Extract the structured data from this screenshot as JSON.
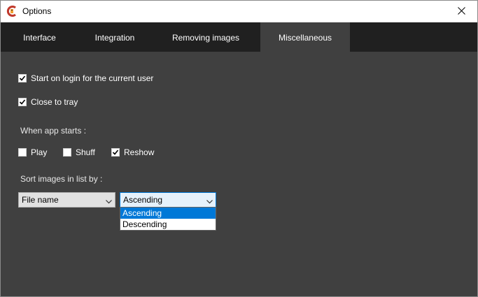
{
  "window": {
    "title": "Options"
  },
  "tabs": [
    {
      "label": "Interface"
    },
    {
      "label": "Integration"
    },
    {
      "label": "Removing images"
    },
    {
      "label": "Miscellaneous",
      "active": true
    }
  ],
  "misc": {
    "start_on_login": {
      "label": "Start on login for the current user",
      "checked": true
    },
    "close_to_tray": {
      "label": "Close to tray",
      "checked": true
    },
    "when_app_starts_label": "When app starts :",
    "play": {
      "label": "Play",
      "checked": false
    },
    "shuff": {
      "label": "Shuff",
      "checked": false
    },
    "reshow": {
      "label": "Reshow",
      "checked": true
    },
    "sort_label": "Sort images in list by :",
    "sort_field": {
      "value": "File name"
    },
    "sort_order": {
      "value": "Ascending",
      "options": [
        "Ascending",
        "Descending"
      ],
      "highlighted": "Ascending"
    }
  },
  "colors": {
    "background": "#404040",
    "tabbar": "#202020",
    "accent": "#0078d7"
  },
  "icons": {
    "app": "app-logo-icon",
    "close": "close-icon",
    "check": "checkmark-icon",
    "chevron": "chevron-down-icon"
  }
}
